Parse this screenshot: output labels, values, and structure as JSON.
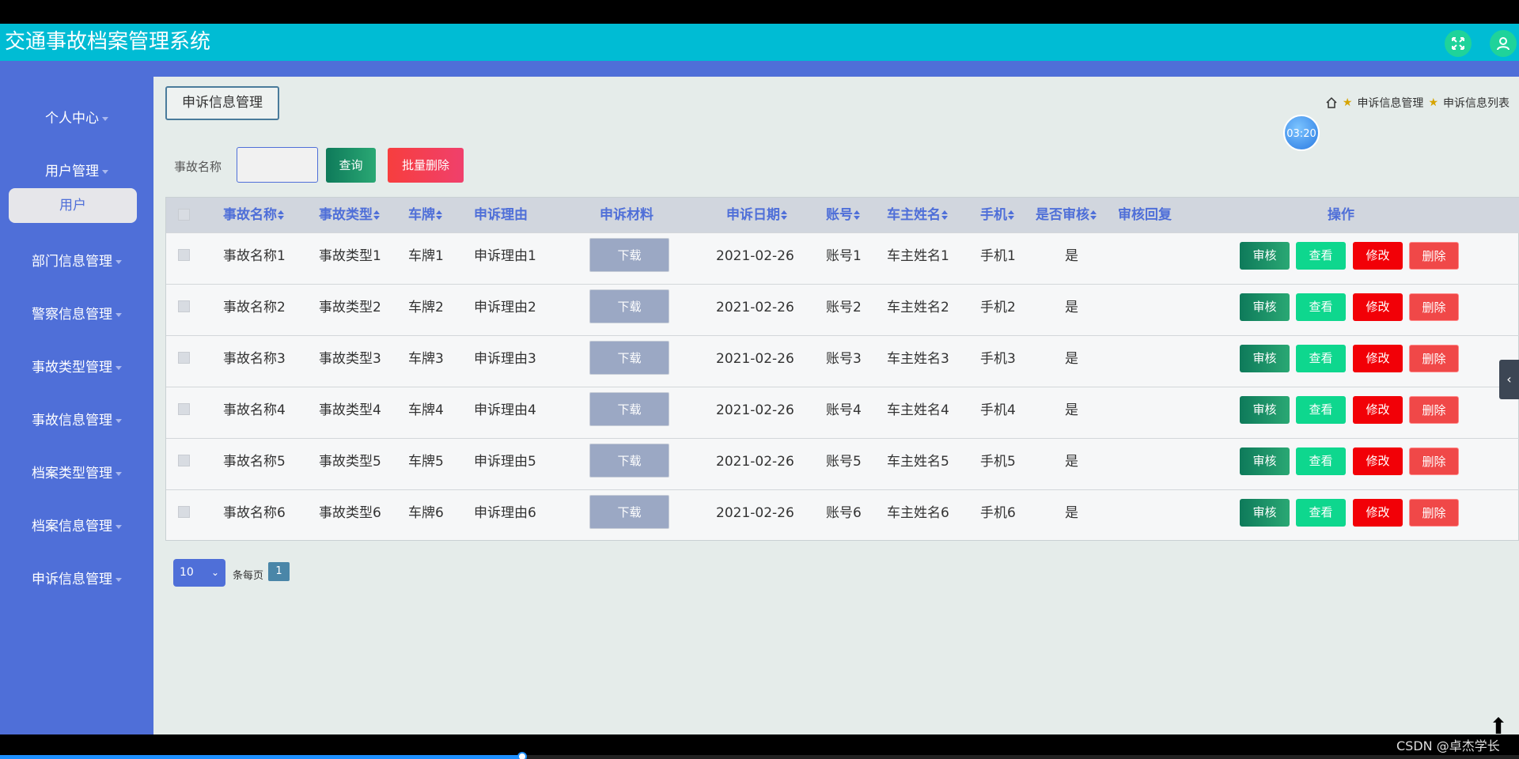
{
  "app": {
    "title": "交通事故档案管理系统"
  },
  "header_icons": {
    "fullscreen": "fullscreen-icon",
    "user": "user-icon"
  },
  "sidebar": {
    "items": [
      {
        "label": "个人中心"
      },
      {
        "label": "用户管理"
      },
      {
        "label": "部门信息管理"
      },
      {
        "label": "警察信息管理"
      },
      {
        "label": "事故类型管理"
      },
      {
        "label": "事故信息管理"
      },
      {
        "label": "档案类型管理"
      },
      {
        "label": "档案信息管理"
      },
      {
        "label": "申诉信息管理"
      }
    ],
    "submenu_user": "用户"
  },
  "page": {
    "tag": "申诉信息管理",
    "breadcrumb": [
      "申诉信息管理",
      "申诉信息列表"
    ],
    "timer": "03:20"
  },
  "search": {
    "label": "事故名称",
    "value": "",
    "query_label": "查询",
    "batch_delete_label": "批量删除"
  },
  "table": {
    "headers": [
      "事故名称",
      "事故类型",
      "车牌",
      "申诉理由",
      "申诉材料",
      "申诉日期",
      "账号",
      "车主姓名",
      "手机",
      "是否审核",
      "审核回复",
      "操作"
    ],
    "download_label": "下载",
    "actions": {
      "audit": "审核",
      "view": "查看",
      "edit": "修改",
      "delete": "删除"
    },
    "rows": [
      {
        "name": "事故名称1",
        "type": "事故类型1",
        "plate": "车牌1",
        "reason": "申诉理由1",
        "date": "2021-02-26",
        "account": "账号1",
        "owner": "车主姓名1",
        "phone": "手机1",
        "audited": "是",
        "reply": ""
      },
      {
        "name": "事故名称2",
        "type": "事故类型2",
        "plate": "车牌2",
        "reason": "申诉理由2",
        "date": "2021-02-26",
        "account": "账号2",
        "owner": "车主姓名2",
        "phone": "手机2",
        "audited": "是",
        "reply": ""
      },
      {
        "name": "事故名称3",
        "type": "事故类型3",
        "plate": "车牌3",
        "reason": "申诉理由3",
        "date": "2021-02-26",
        "account": "账号3",
        "owner": "车主姓名3",
        "phone": "手机3",
        "audited": "是",
        "reply": ""
      },
      {
        "name": "事故名称4",
        "type": "事故类型4",
        "plate": "车牌4",
        "reason": "申诉理由4",
        "date": "2021-02-26",
        "account": "账号4",
        "owner": "车主姓名4",
        "phone": "手机4",
        "audited": "是",
        "reply": ""
      },
      {
        "name": "事故名称5",
        "type": "事故类型5",
        "plate": "车牌5",
        "reason": "申诉理由5",
        "date": "2021-02-26",
        "account": "账号5",
        "owner": "车主姓名5",
        "phone": "手机5",
        "audited": "是",
        "reply": ""
      },
      {
        "name": "事故名称6",
        "type": "事故类型6",
        "plate": "车牌6",
        "reason": "申诉理由6",
        "date": "2021-02-26",
        "account": "账号6",
        "owner": "车主姓名6",
        "phone": "手机6",
        "audited": "是",
        "reply": ""
      }
    ]
  },
  "pagination": {
    "page_size": "10",
    "per_page_label": "条每页",
    "current_page": "1"
  },
  "watermark": "CSDN @卓杰学长",
  "colors": {
    "topbar": "#00bcd4",
    "sidebar": "#4f6fd8",
    "accent_green": "#0e7a5a",
    "danger": "#f20007"
  }
}
